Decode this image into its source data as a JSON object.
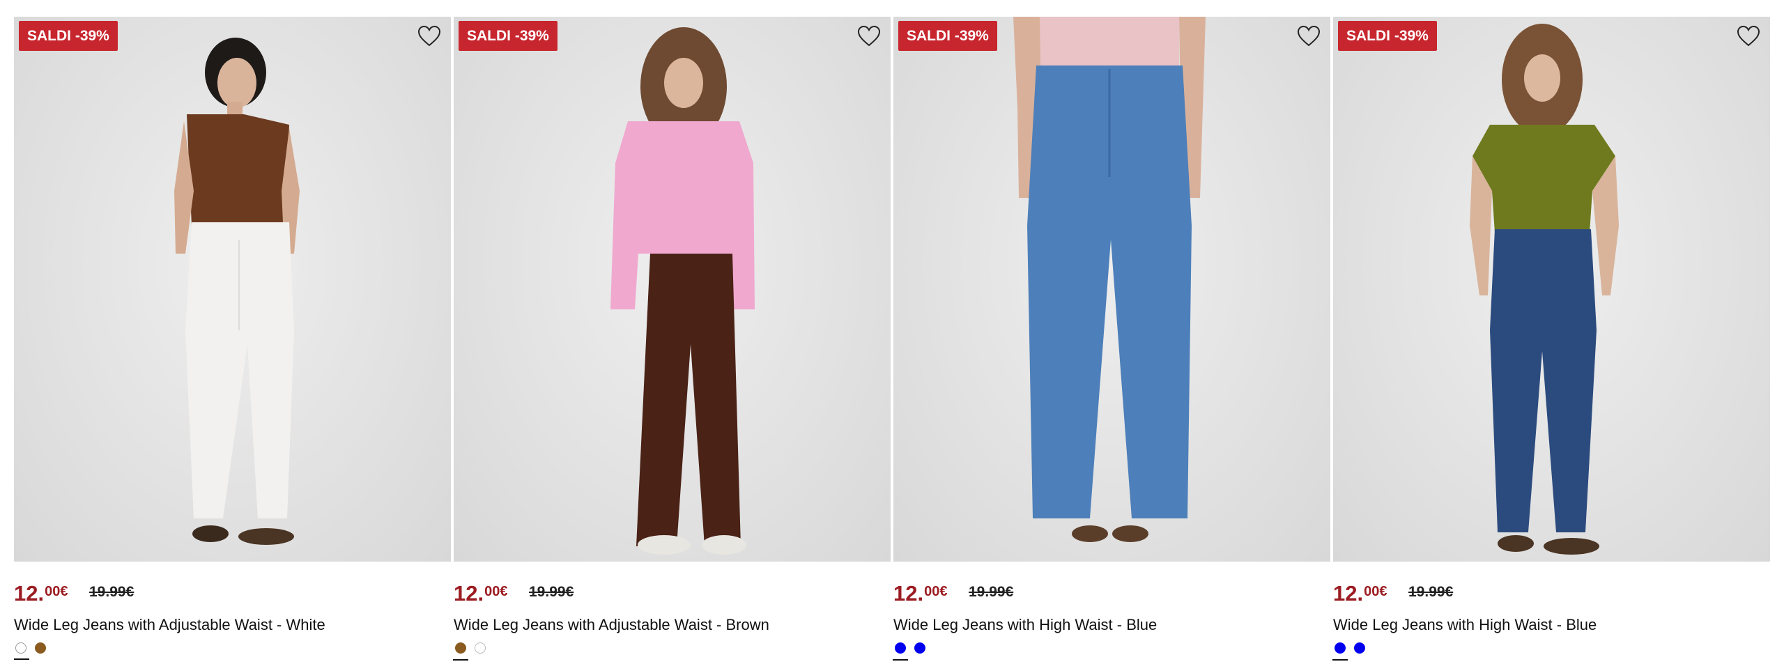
{
  "colors": {
    "badge": "#c8262e",
    "price": "#9b1c22",
    "white_swatch": "#ffffff",
    "brown_swatch": "#8a5a1e",
    "blue_swatch": "#0000ee"
  },
  "products": [
    {
      "badge": "SALDI -39%",
      "price_int": "12.",
      "price_dec": "00€",
      "price_old": "19.99€",
      "title": "Wide Leg Jeans with Adjustable Waist - White",
      "swatches": [
        "white",
        "brown"
      ],
      "selected_swatch": 0
    },
    {
      "badge": "SALDI -39%",
      "price_int": "12.",
      "price_dec": "00€",
      "price_old": "19.99€",
      "title": "Wide Leg Jeans with Adjustable Waist - Brown",
      "swatches": [
        "brown",
        "white"
      ],
      "selected_swatch": 0
    },
    {
      "badge": "SALDI -39%",
      "price_int": "12.",
      "price_dec": "00€",
      "price_old": "19.99€",
      "title": "Wide Leg Jeans with High Waist - Blue",
      "swatches": [
        "blue",
        "blue"
      ],
      "selected_swatch": 0
    },
    {
      "badge": "SALDI -39%",
      "price_int": "12.",
      "price_dec": "00€",
      "price_old": "19.99€",
      "title": "Wide Leg Jeans with High Waist - Blue",
      "swatches": [
        "blue",
        "blue"
      ],
      "selected_swatch": 0
    }
  ],
  "icons": {
    "favorite": "heart-outline-icon"
  }
}
